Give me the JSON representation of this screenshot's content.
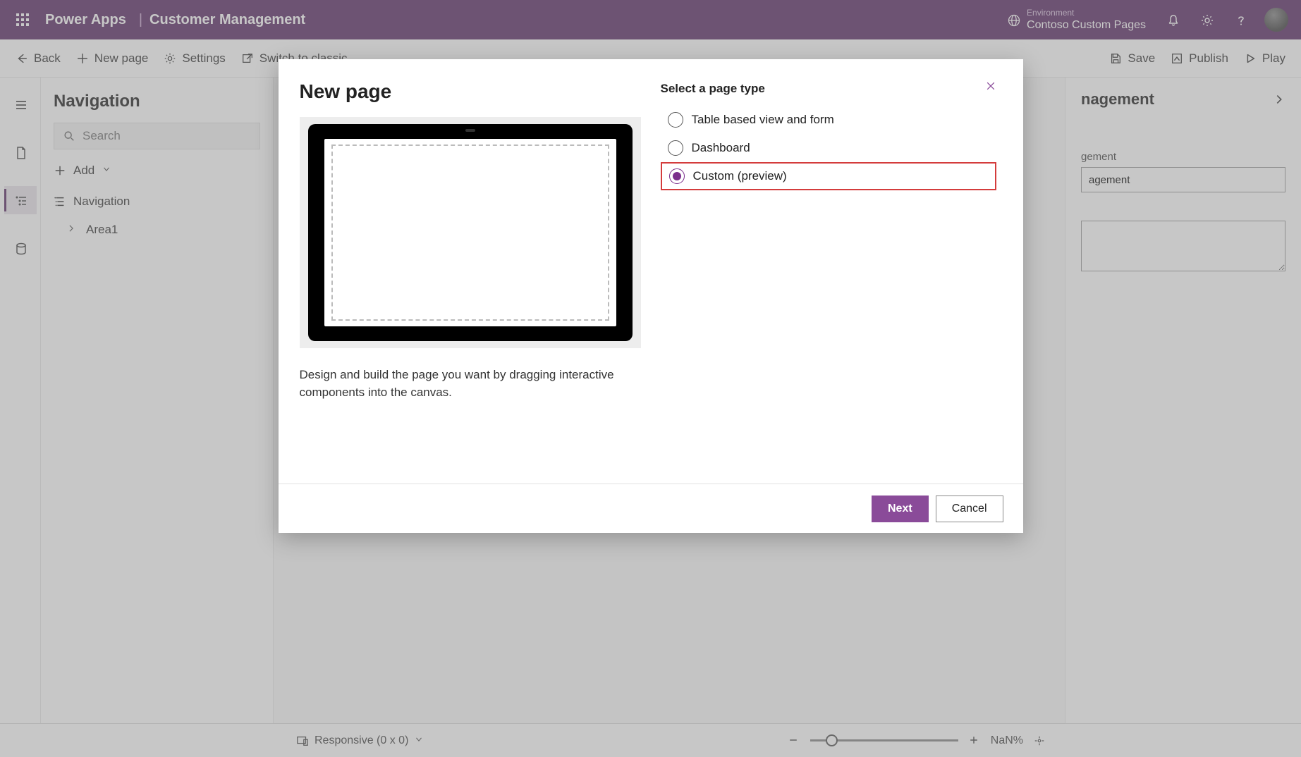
{
  "header": {
    "brand": "Power Apps",
    "app_title": "Customer Management",
    "env_label": "Environment",
    "env_name": "Contoso Custom Pages"
  },
  "cmdbar": {
    "back": "Back",
    "new_page": "New page",
    "settings": "Settings",
    "switch": "Switch to classic",
    "save": "Save",
    "publish": "Publish",
    "play": "Play"
  },
  "navpanel": {
    "title": "Navigation",
    "search_placeholder": "Search",
    "add": "Add",
    "root_label": "Navigation",
    "area_label": "Area1"
  },
  "rightpanel": {
    "title_suffix": "nagement",
    "value1_suffix": "gement",
    "value2_suffix": "agement"
  },
  "footer": {
    "responsive": "Responsive (0 x 0)",
    "zoom": "NaN%"
  },
  "modal": {
    "title": "New page",
    "description": "Design and build the page you want by dragging interactive components into the canvas.",
    "select_label": "Select a page type",
    "options": {
      "table": "Table based view and form",
      "dashboard": "Dashboard",
      "custom": "Custom (preview)"
    },
    "next": "Next",
    "cancel": "Cancel"
  }
}
